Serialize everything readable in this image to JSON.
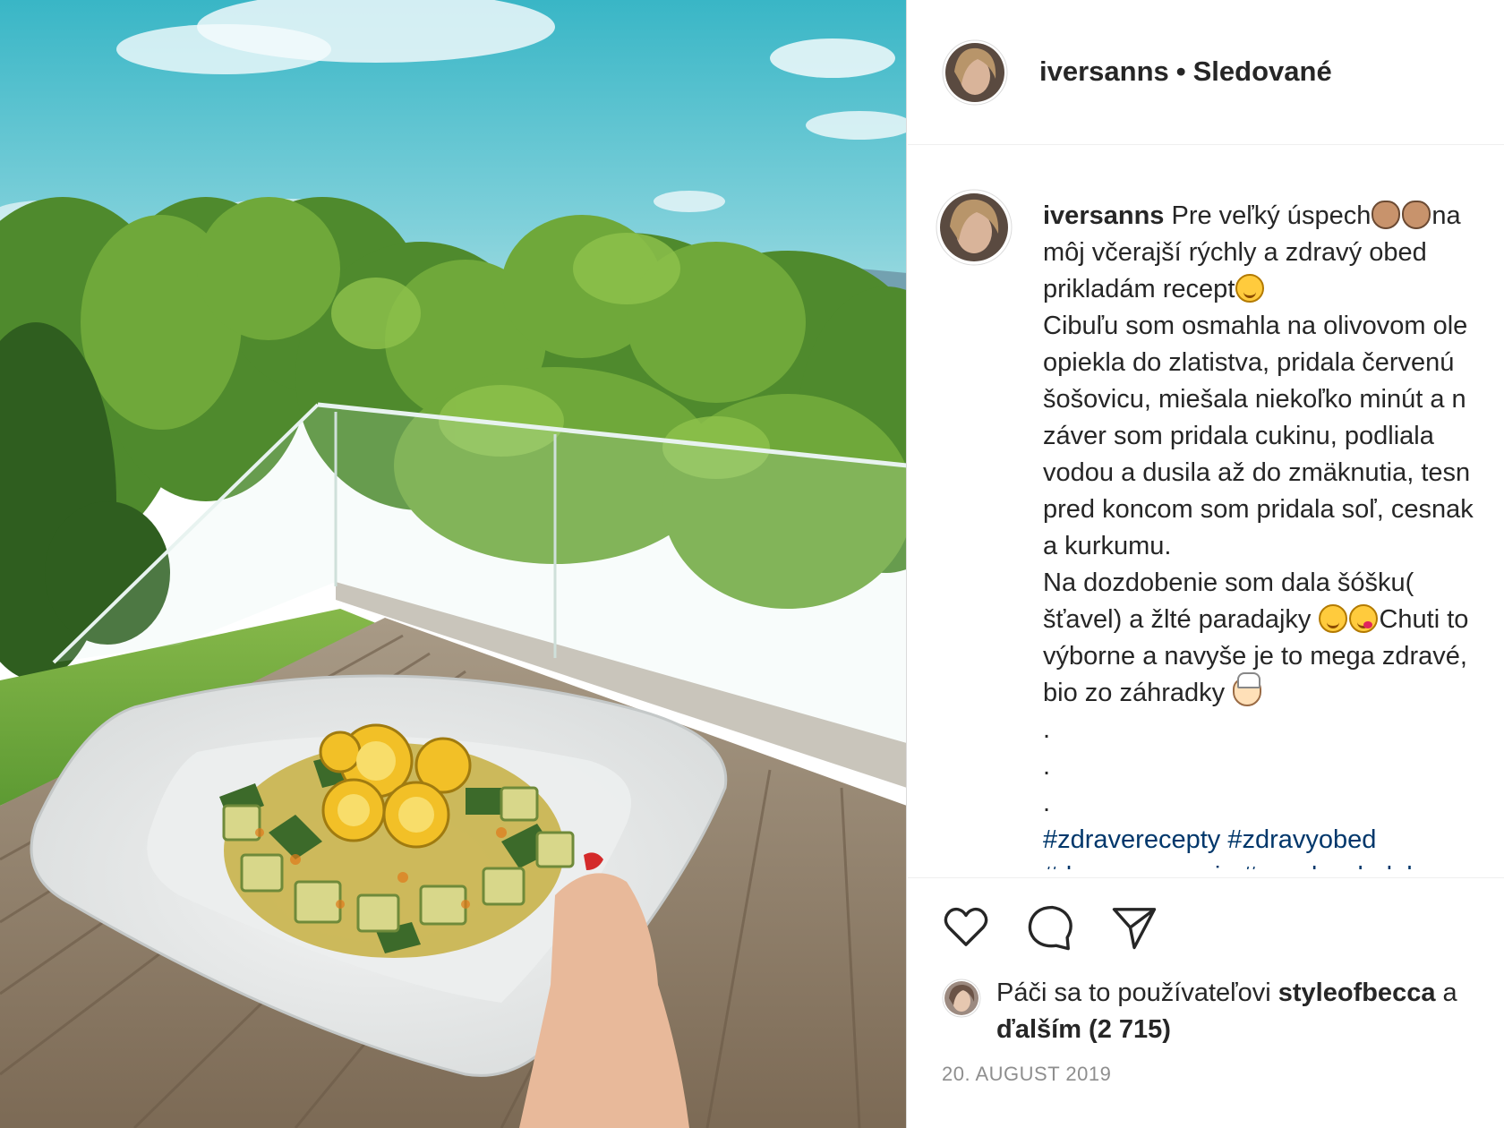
{
  "header": {
    "username": "iversanns",
    "separator": "•",
    "follow_status": "Sledované"
  },
  "caption": {
    "username": "iversanns",
    "lines": {
      "l1": "Pre veľký úspech",
      "l1b": "na",
      "l2": "môj včerajší rýchly a zdravý obed",
      "l3": "prikladám recept",
      "l4": "Cibuľu som osmahla na olivovom ole",
      "l5": "opiekla do zlatistva, pridala červenú",
      "l6": "šošovicu, miešala niekoľko minút a n",
      "l7": "záver som pridala cukinu, podliala",
      "l8": "vodou a dusila až do zmäknutia, tesn",
      "l9": "pred koncom som pridala soľ, cesnak",
      "l10": "a kurkumu.",
      "l11": "Na dozdobenie som dala šóšku(",
      "l12a": "šťavel) a žlté paradajky",
      "l12b": "Chuti to",
      "l13": "výborne a navyše je to mega zdravé,",
      "l14": "bio zo záhradky",
      "dot": ".",
      "hashtags_1": "#zdraverecepty #zdravyobed",
      "hashtags_2": "#domacevarenie #zozahradodole"
    }
  },
  "actions": {
    "icons": [
      "heart-icon",
      "comment-icon",
      "share-icon"
    ]
  },
  "likes": {
    "prefix": "Páči sa to používateľovi",
    "user": "styleofbecca",
    "conj": "a",
    "others": "ďalším (2 715)"
  },
  "timestamp": "20. AUGUST 2019",
  "colors": {
    "hashtag": "#00376b",
    "text": "#262626",
    "muted": "#8e8e8e",
    "divider": "#efefef"
  }
}
